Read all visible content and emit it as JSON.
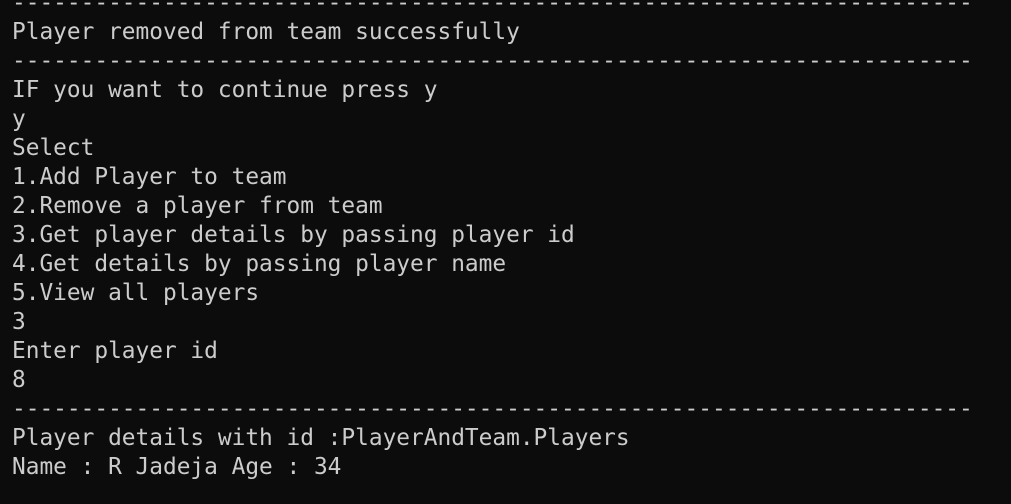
{
  "terminal": {
    "lines": [
      "----------------------------------------------------------------------",
      "Player removed from team successfully",
      "----------------------------------------------------------------------",
      "IF you want to continue press y",
      "y",
      "Select",
      "1.Add Player to team",
      "2.Remove a player from team",
      "3.Get player details by passing player id",
      "4.Get details by passing player name",
      "5.View all players",
      "3",
      "Enter player id",
      "8",
      "----------------------------------------------------------------------",
      "Player details with id :PlayerAndTeam.Players",
      "Name : R Jadeja Age : 34",
      "----------------------------------------------------------------------"
    ]
  },
  "colors": {
    "background": "#0c0c0c",
    "text": "#cccccc"
  }
}
